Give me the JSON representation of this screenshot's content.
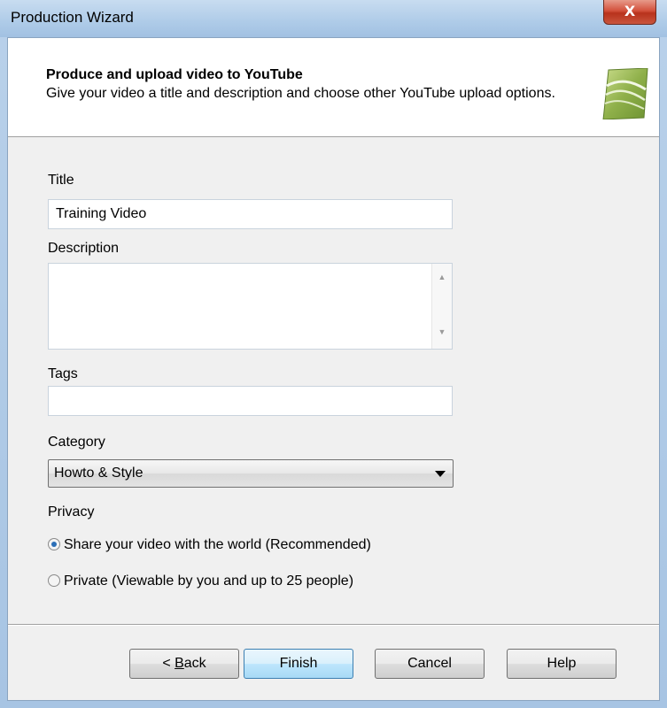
{
  "window": {
    "title": "Production Wizard",
    "close_label": "X"
  },
  "header": {
    "title": "Produce and upload video to YouTube",
    "subtitle": "Give your video a title and description and choose other YouTube upload options."
  },
  "form": {
    "title_label": "Title",
    "title_value": "Training Video",
    "description_label": "Description",
    "description_value": "",
    "tags_label": "Tags",
    "tags_value": "",
    "category_label": "Category",
    "category_value": "Howto & Style",
    "privacy_label": "Privacy",
    "privacy_options": [
      {
        "label": "Share your video with the world (Recommended)",
        "selected": true
      },
      {
        "label": "Private (Viewable by you and up to 25 people)",
        "selected": false
      }
    ]
  },
  "buttons": {
    "back_prefix": "< ",
    "back_mnemonic": "B",
    "back_rest": "ack",
    "finish": "Finish",
    "cancel": "Cancel",
    "help": "Help"
  }
}
